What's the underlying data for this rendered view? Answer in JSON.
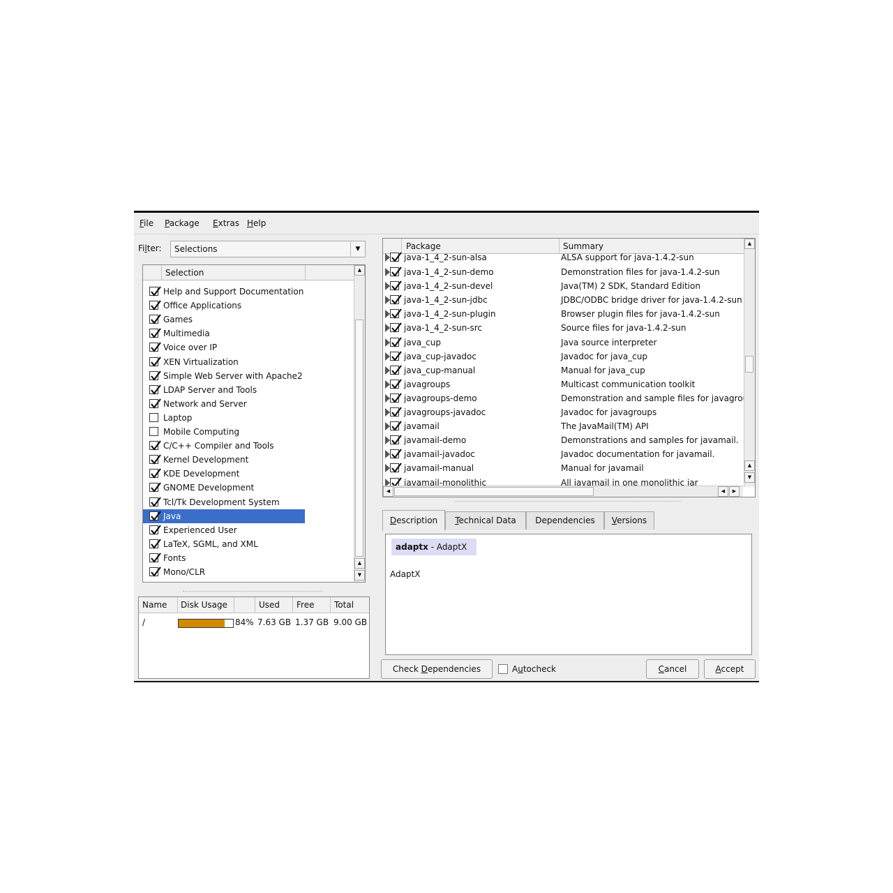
{
  "menu": [
    {
      "first": "F",
      "rest": "ile"
    },
    {
      "first": "P",
      "rest": "ackage"
    },
    {
      "first": "E",
      "rest": "xtras"
    },
    {
      "first": "H",
      "rest": "elp"
    }
  ],
  "filter": {
    "label_pre": "Fi",
    "label_u": "l",
    "label_post": "ter:",
    "value": "Selections"
  },
  "selection_header": "Selection",
  "selections": [
    {
      "label": "Help and Support Documentation",
      "checked": true
    },
    {
      "label": "Office Applications",
      "checked": true
    },
    {
      "label": "Games",
      "checked": true
    },
    {
      "label": "Multimedia",
      "checked": true
    },
    {
      "label": "Voice over IP",
      "checked": true
    },
    {
      "label": "XEN Virtualization",
      "checked": true
    },
    {
      "label": "Simple Web Server with Apache2",
      "checked": true
    },
    {
      "label": "LDAP Server and Tools",
      "checked": true
    },
    {
      "label": "Network and Server",
      "checked": true
    },
    {
      "label": "Laptop",
      "checked": false
    },
    {
      "label": "Mobile Computing",
      "checked": false
    },
    {
      "label": "C/C++ Compiler and Tools",
      "checked": true
    },
    {
      "label": "Kernel Development",
      "checked": true
    },
    {
      "label": "KDE Development",
      "checked": true
    },
    {
      "label": "GNOME Development",
      "checked": true
    },
    {
      "label": "Tcl/Tk Development System",
      "checked": true
    },
    {
      "label": "Java",
      "checked": true,
      "selected": true
    },
    {
      "label": "Experienced User",
      "checked": true
    },
    {
      "label": "LaTeX, SGML, and XML",
      "checked": true
    },
    {
      "label": "Fonts",
      "checked": true
    },
    {
      "label": "Mono/CLR",
      "checked": true
    }
  ],
  "disk": {
    "headers": [
      "Name",
      "Disk Usage",
      "Used",
      "Free",
      "Total"
    ],
    "rows": [
      {
        "name": "/",
        "percent": "84%",
        "used": "7.63 GB",
        "free": "1.37 GB",
        "total": "9.00 GB",
        "fraction": 0.84
      }
    ]
  },
  "packages": {
    "headers": {
      "package": "Package",
      "summary": "Summary"
    },
    "partial_top": {
      "name": "java-1_4_2-sun-alsa",
      "summary": "ALSA support for java-1.4.2-sun"
    },
    "rows": [
      {
        "name": "java-1_4_2-sun-demo",
        "summary": "Demonstration files for java-1.4.2-sun"
      },
      {
        "name": "java-1_4_2-sun-devel",
        "summary": "Java(TM) 2 SDK, Standard Edition"
      },
      {
        "name": "java-1_4_2-sun-jdbc",
        "summary": "JDBC/ODBC bridge driver for java-1.4.2-sun"
      },
      {
        "name": "java-1_4_2-sun-plugin",
        "summary": "Browser plugin files for java-1.4.2-sun"
      },
      {
        "name": "java-1_4_2-sun-src",
        "summary": "Source files for java-1.4.2-sun"
      },
      {
        "name": "java_cup",
        "summary": "Java source interpreter"
      },
      {
        "name": "java_cup-javadoc",
        "summary": "Javadoc for java_cup"
      },
      {
        "name": "java_cup-manual",
        "summary": "Manual for java_cup"
      },
      {
        "name": "javagroups",
        "summary": "Multicast communication toolkit"
      },
      {
        "name": "javagroups-demo",
        "summary": "Demonstration and sample files for javagrou"
      },
      {
        "name": "javagroups-javadoc",
        "summary": "Javadoc for javagroups"
      },
      {
        "name": "javamail",
        "summary": "The JavaMail(TM) API"
      },
      {
        "name": "javamail-demo",
        "summary": "Demonstrations and samples for javamail."
      },
      {
        "name": "javamail-javadoc",
        "summary": "Javadoc documentation for javamail."
      },
      {
        "name": "javamail-manual",
        "summary": "Manual for javamail"
      }
    ],
    "partial_bottom": {
      "name": "javamail-monolithic",
      "summary": "All javamail in one monolithic jar"
    }
  },
  "tabs": [
    {
      "pre": "",
      "u": "D",
      "post": "escription"
    },
    {
      "pre": "",
      "u": "T",
      "post": "echnical Data"
    },
    {
      "pre": "Dependencies",
      "u": "",
      "post": ""
    },
    {
      "pre": "",
      "u": "V",
      "post": "ersions"
    }
  ],
  "description": {
    "pkg_name": "adaptx",
    "pkg_summary": " - AdaptX",
    "body": "AdaptX"
  },
  "buttons": {
    "check_deps": {
      "pre": "Check ",
      "u": "D",
      "post": "ependencies"
    },
    "autocheck": {
      "pre": "A",
      "u": "u",
      "post": "tocheck"
    },
    "cancel": {
      "pre": "",
      "u": "C",
      "post": "ancel"
    },
    "accept": {
      "pre": "",
      "u": "A",
      "post": "ccept"
    }
  }
}
